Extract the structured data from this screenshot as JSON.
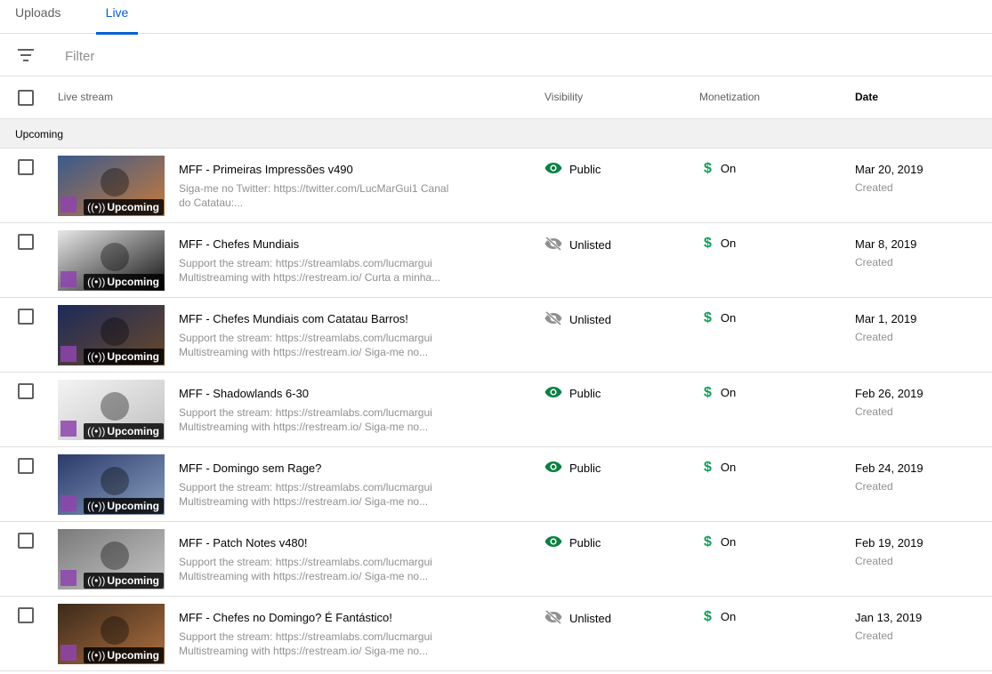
{
  "tabs": {
    "uploads": "Uploads",
    "live": "Live"
  },
  "filter": {
    "placeholder": "Filter"
  },
  "columns": {
    "stream": "Live stream",
    "visibility": "Visibility",
    "monetization": "Monetization",
    "date": "Date"
  },
  "section": "Upcoming",
  "badge_label": "Upcoming",
  "colors": {
    "accent": "#065fd4",
    "public": "#0b8043",
    "unlisted": "#909090",
    "monetized": "#0f9d58"
  },
  "rows": [
    {
      "title": "MFF - Primeiras Impressões v490",
      "desc1": "Siga-me no Twitter: https://twitter.com/LucMarGui1 Canal",
      "desc2": "do Catatau:...",
      "visibility": "Public",
      "visibility_icon": "eye-icon",
      "monetization": "On",
      "date": "Mar 20, 2019",
      "date_sub": "Created"
    },
    {
      "title": "MFF - Chefes Mundiais",
      "desc1": "Support the stream: https://streamlabs.com/lucmargui",
      "desc2": "Multistreaming with https://restream.io/ Curta a minha...",
      "visibility": "Unlisted",
      "visibility_icon": "eye-off-icon",
      "monetization": "On",
      "date": "Mar 8, 2019",
      "date_sub": "Created"
    },
    {
      "title": "MFF - Chefes Mundiais com Catatau Barros!",
      "desc1": "Support the stream: https://streamlabs.com/lucmargui",
      "desc2": "Multistreaming with https://restream.io/ Siga-me no...",
      "visibility": "Unlisted",
      "visibility_icon": "eye-off-icon",
      "monetization": "On",
      "date": "Mar 1, 2019",
      "date_sub": "Created"
    },
    {
      "title": "MFF - Shadowlands 6-30",
      "desc1": "Support the stream: https://streamlabs.com/lucmargui",
      "desc2": "Multistreaming with https://restream.io/ Siga-me no...",
      "visibility": "Public",
      "visibility_icon": "eye-icon",
      "monetization": "On",
      "date": "Feb 26, 2019",
      "date_sub": "Created"
    },
    {
      "title": "MFF - Domingo sem Rage?",
      "desc1": "Support the stream: https://streamlabs.com/lucmargui",
      "desc2": "Multistreaming with https://restream.io/ Siga-me no...",
      "visibility": "Public",
      "visibility_icon": "eye-icon",
      "monetization": "On",
      "date": "Feb 24, 2019",
      "date_sub": "Created"
    },
    {
      "title": "MFF - Patch Notes v480!",
      "desc1": "Support the stream: https://streamlabs.com/lucmargui",
      "desc2": "Multistreaming with https://restream.io/ Siga-me no...",
      "visibility": "Public",
      "visibility_icon": "eye-icon",
      "monetization": "On",
      "date": "Feb 19, 2019",
      "date_sub": "Created"
    },
    {
      "title": "MFF - Chefes no Domingo? É Fantástico!",
      "desc1": "Support the stream: https://streamlabs.com/lucmargui",
      "desc2": "Multistreaming with https://restream.io/ Siga-me no...",
      "visibility": "Unlisted",
      "visibility_icon": "eye-off-icon",
      "monetization": "On",
      "date": "Jan 13, 2019",
      "date_sub": "Created"
    }
  ]
}
